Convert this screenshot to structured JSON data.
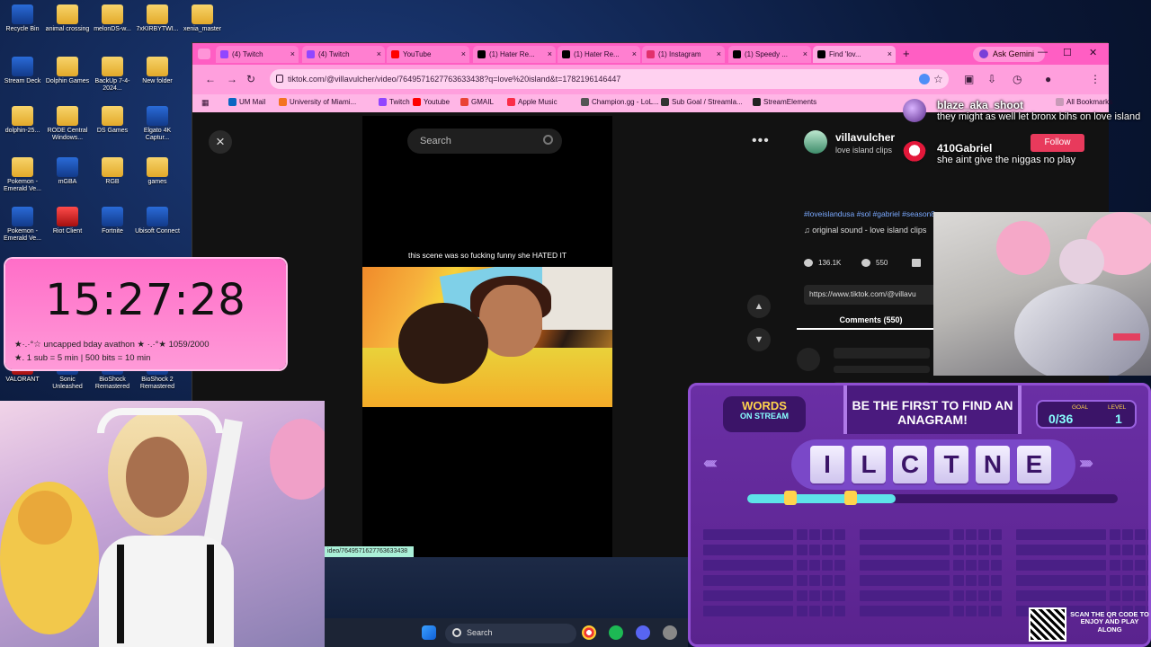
{
  "desktop": {
    "icons": [
      {
        "label": "Recycle Bin",
        "kind": "app"
      },
      {
        "label": "animal crossing",
        "kind": "folder"
      },
      {
        "label": "melonDS-w...",
        "kind": "folder"
      },
      {
        "label": "7xKIRBYTWI...",
        "kind": "folder"
      },
      {
        "label": "xenia_master",
        "kind": "folder"
      },
      {
        "label": "Stream Deck",
        "kind": "app"
      },
      {
        "label": "Dolphin Games",
        "kind": "folder"
      },
      {
        "label": "BackUp 7-4-2024...",
        "kind": "folder"
      },
      {
        "label": "New folder",
        "kind": "folder"
      },
      {
        "label": "dolphin-25...",
        "kind": "folder"
      },
      {
        "label": "RODE Central Windows...",
        "kind": "folder"
      },
      {
        "label": "DS Games",
        "kind": "folder"
      },
      {
        "label": "Elgato 4K Captur...",
        "kind": "app"
      },
      {
        "label": "Pokemon - Emerald Ve...",
        "kind": "folder"
      },
      {
        "label": "mGBA",
        "kind": "app"
      },
      {
        "label": "RGB",
        "kind": "folder"
      },
      {
        "label": "games",
        "kind": "folder"
      },
      {
        "label": "Pokemon - Emerald Ve...",
        "kind": "app"
      },
      {
        "label": "Riot Client",
        "kind": "red"
      },
      {
        "label": "Fortnite",
        "kind": "app"
      },
      {
        "label": "Ubisoft Connect",
        "kind": "app"
      },
      {
        "label": "VALORANT",
        "kind": "red"
      },
      {
        "label": "Sonic Unleashed",
        "kind": "app"
      },
      {
        "label": "BioShock Remastered",
        "kind": "app"
      },
      {
        "label": "BioShock 2 Remastered",
        "kind": "app"
      }
    ]
  },
  "browser": {
    "tabs": [
      {
        "label": "(4) Twitch",
        "color": "#9146ff"
      },
      {
        "label": "(4) Twitch",
        "color": "#9146ff"
      },
      {
        "label": "YouTube",
        "color": "#ff0000"
      },
      {
        "label": "(1) Hater Re...",
        "color": "#000000"
      },
      {
        "label": "(1) Hater Re...",
        "color": "#000000"
      },
      {
        "label": "(1) Instagram",
        "color": "#e1306c"
      },
      {
        "label": "(1) Speedy ...",
        "color": "#000000"
      },
      {
        "label": "Find 'lov...",
        "color": "#000000"
      }
    ],
    "ask_gemini": "Ask Gemini",
    "url": "tiktok.com/@villavulcher/video/7649571627763633438?q=love%20island&t=1782196146447",
    "bookmarks": [
      {
        "label": "UM Mail",
        "color": "#0a66c2"
      },
      {
        "label": "University of Miami...",
        "color": "#f47321"
      },
      {
        "label": "Twitch",
        "color": "#9146ff"
      },
      {
        "label": "Youtube",
        "color": "#ff0000"
      },
      {
        "label": "GMAIL",
        "color": "#ea4335"
      },
      {
        "label": "Apple Music",
        "color": "#fa2d48"
      },
      {
        "label": "Champion.gg - LoL...",
        "color": "#555555"
      },
      {
        "label": "Sub Goal / Streamla...",
        "color": "#333333"
      },
      {
        "label": "StreamElements",
        "color": "#222222"
      }
    ],
    "all_bookmarks": "All Bookmarks"
  },
  "tiktok": {
    "search_placeholder": "Search",
    "caption": "this scene was so fucking funny she HATED IT",
    "author": "villavulcher",
    "author_sub": "love island clips",
    "hashtags": "#loveislandusa #sol #gabriel #season8",
    "sound": "original sound - love island clips",
    "likes": "136.1K",
    "comments_count": "550",
    "share_url": "https://www.tiktok.com/@villavu",
    "comments_tab": "Comments (550)"
  },
  "chat": [
    {
      "user": "blaze_aka_shoot",
      "message": "they might as well let bronx bihs on love island"
    },
    {
      "user": "410Gabriel",
      "message": "she aint give the niggas no play",
      "follow_label": "Follow"
    }
  ],
  "timer": {
    "time": "15:27:28",
    "line1": "★·.·°☆ uncapped bday avathon ★ ·.·°★ 1059/2000",
    "line2": "★. 1 sub = 5 min | 500 bits = 10 min"
  },
  "game": {
    "logo_line1": "WORDS",
    "logo_line2": "ON STREAM",
    "banner": "BE THE FIRST TO FIND AN ANAGRAM!",
    "goal_label": "GOAL",
    "goal_value": "0/36",
    "level_label": "LEVEL",
    "level_value": "1",
    "letters": [
      "I",
      "L",
      "C",
      "T",
      "N",
      "E"
    ],
    "progress": 0.4,
    "qr_text": "SCAN THE QR CODE TO ENJOY AND PLAY ALONG"
  },
  "taskbar": {
    "search": "Search",
    "url_tooltip": "ideo/7649571627763633438"
  },
  "colors": {
    "tabbar": "#ff5ec3",
    "timer": "#ff6ec8",
    "game_purple": "#6a2fa5",
    "follow": "#e83a5c"
  }
}
